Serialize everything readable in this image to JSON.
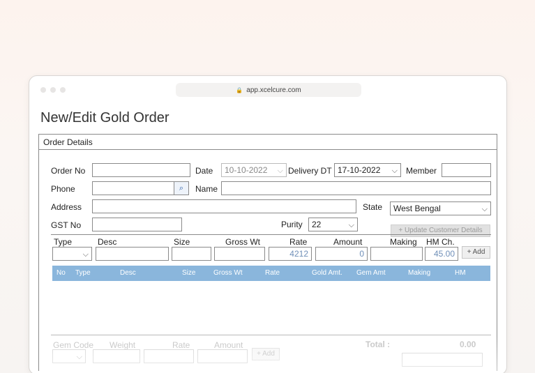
{
  "browser": {
    "url": "app.xcelcure.com"
  },
  "page": {
    "title": "New/Edit Gold Order"
  },
  "panel": {
    "header": "Order Details"
  },
  "form": {
    "order_no_label": "Order No",
    "order_no_value": "",
    "date_label": "Date",
    "date_value": "10-10-2022",
    "delivery_label": "Delivery DT",
    "delivery_value": "17-10-2022",
    "member_label": "Member",
    "member_value": "",
    "phone_label": "Phone",
    "phone_value": "",
    "name_label": "Name",
    "name_value": "",
    "address_label": "Address",
    "address_value": "",
    "state_label": "State",
    "state_value": "West Bengal",
    "gst_label": "GST No",
    "gst_value": "",
    "purity_label": "Purity",
    "purity_value": "22",
    "update_button": "Update Customer Details"
  },
  "item_entry": {
    "type_label": "Type",
    "desc_label": "Desc",
    "size_label": "Size",
    "gross_label": "Gross Wt",
    "rate_label": "Rate",
    "amount_label": "Amount",
    "making_label": "Making",
    "hm_label": "HM Ch.",
    "rate_value": "4212",
    "amount_value": "0",
    "hm_value": "45.00",
    "add_button": "Add"
  },
  "grid": {
    "columns": [
      "No",
      "Type",
      "Desc",
      "Size",
      "Gross Wt",
      "Rate",
      "Gold Amt.",
      "Gem Amt",
      "Making",
      "HM"
    ]
  },
  "gem_entry": {
    "code_label": "Gem Code",
    "weight_label": "Weight",
    "rate_label": "Rate",
    "amount_label": "Amount",
    "add_button": "Add",
    "total_label": "Total :",
    "total_value": "0.00"
  },
  "colors": {
    "grid_header": "#8ab6dc",
    "accent_text": "#6f8fb8"
  }
}
